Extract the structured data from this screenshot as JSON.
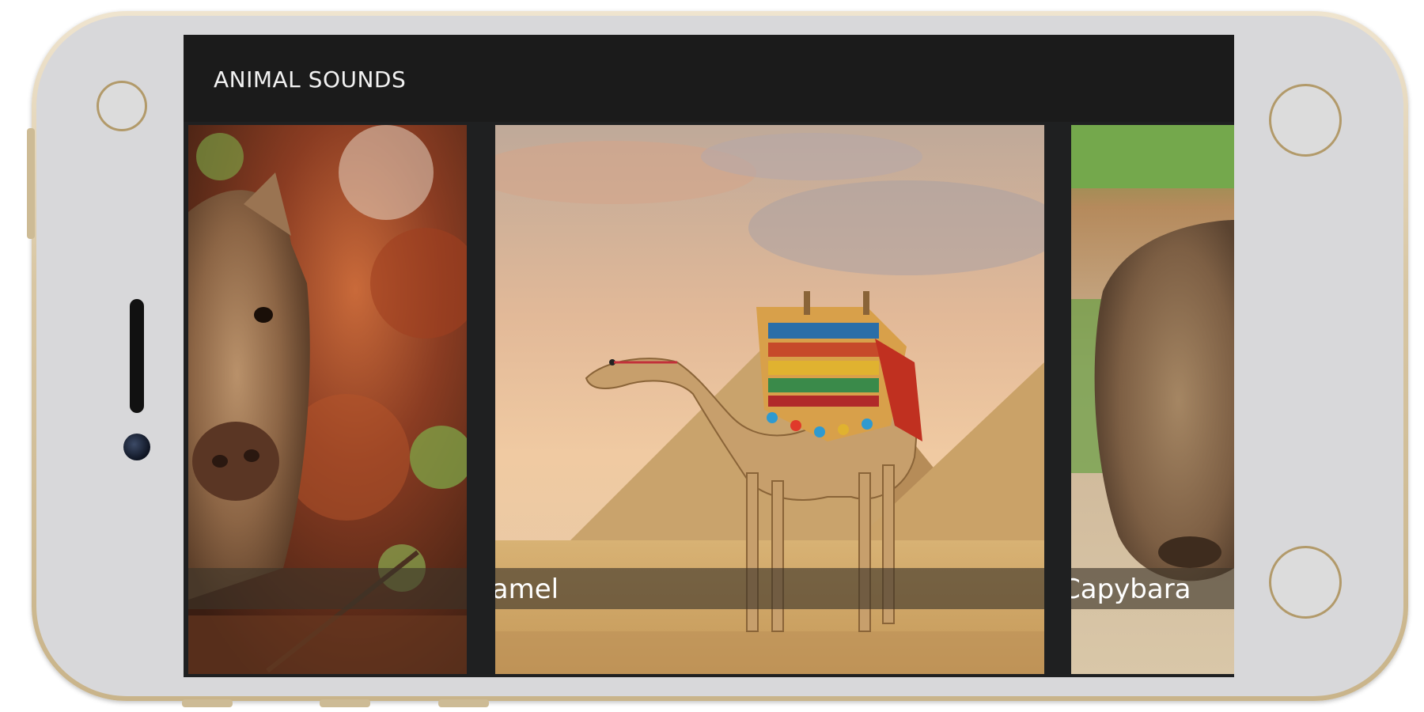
{
  "app": {
    "title": "ANIMAL SOUNDS"
  },
  "cards": [
    {
      "name": "",
      "image": "boar-piglet-photo"
    },
    {
      "name": "Camel",
      "image": "camel-pyramids-photo"
    },
    {
      "name": "Capybara",
      "image": "capybara-photo"
    }
  ],
  "colors": {
    "app_bar": "#1b1b1b",
    "screen_bg": "#1f2021",
    "label_band": "rgba(60,52,40,0.62)",
    "phone_frame": "#d8c6a2"
  }
}
